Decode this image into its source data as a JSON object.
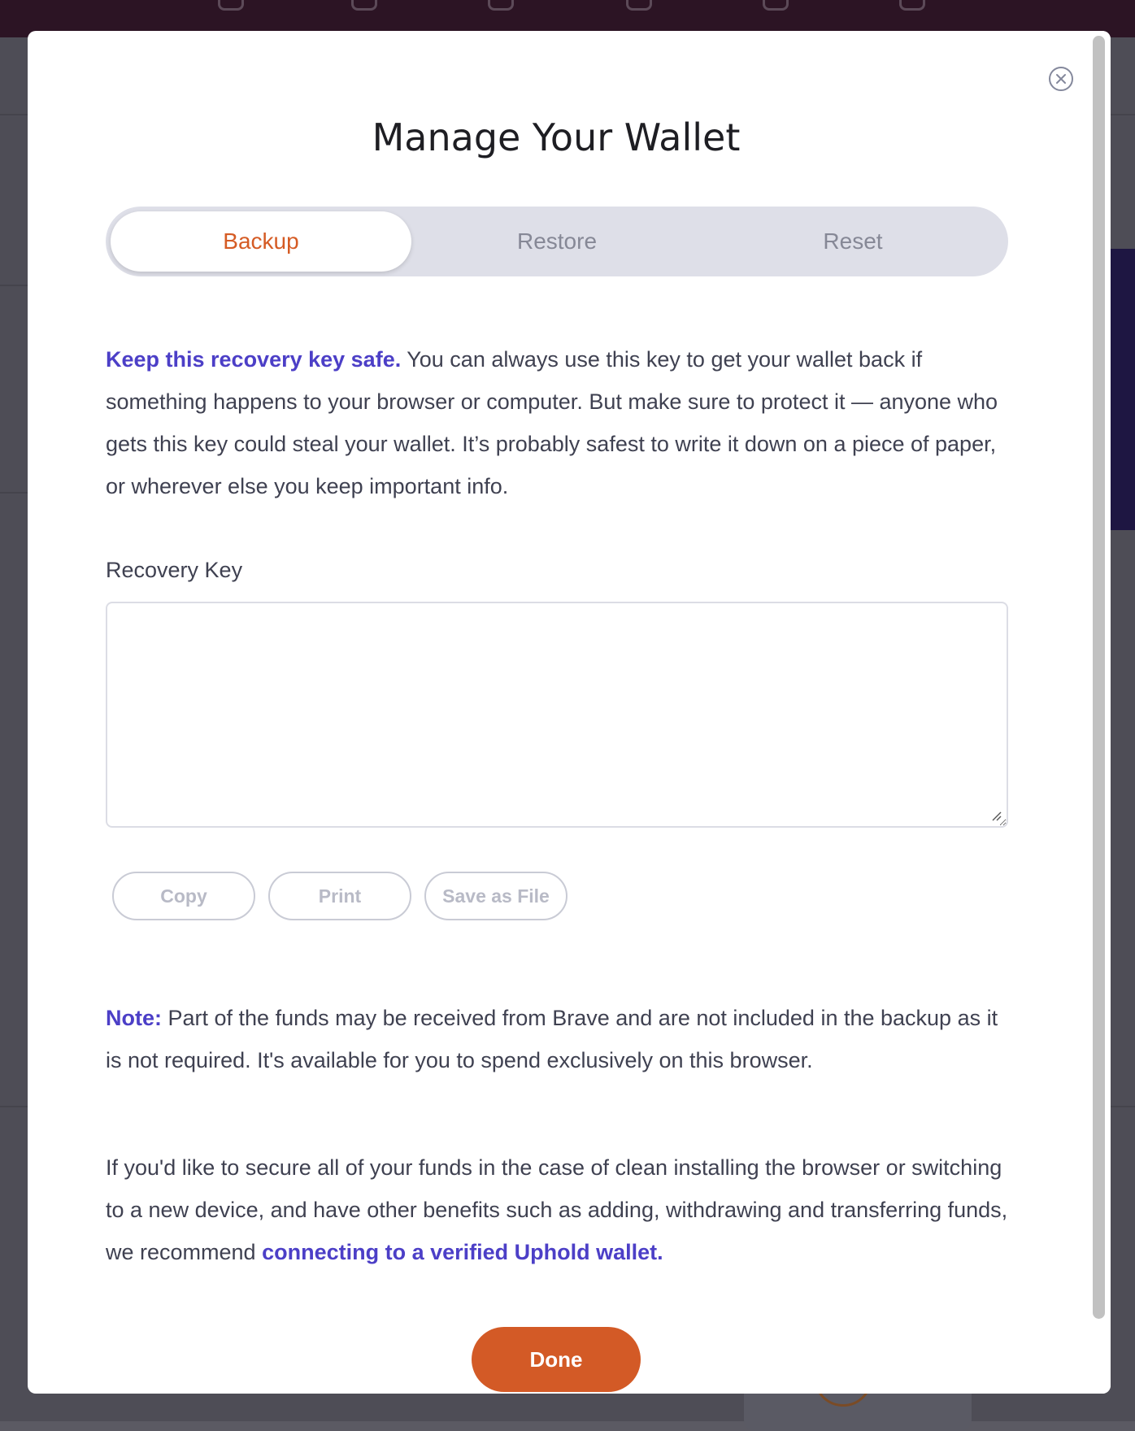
{
  "modal": {
    "title": "Manage Your Wallet",
    "tabs": [
      {
        "label": "Backup",
        "active": true
      },
      {
        "label": "Restore",
        "active": false
      },
      {
        "label": "Reset",
        "active": false
      }
    ],
    "intro": {
      "bold": "Keep this recovery key safe.",
      "text": " You can always use this key to get your wallet back if something happens to your browser or computer. But make sure to protect it — anyone who gets this key could steal your wallet. It’s probably safest to write it down on a piece of paper, or wherever else you keep important info."
    },
    "recovery_key": {
      "label": "Recovery Key",
      "value": ""
    },
    "buttons": {
      "copy": "Copy",
      "print": "Print",
      "save": "Save as File",
      "done": "Done"
    },
    "note": {
      "bold": "Note:",
      "text": " Part of the funds may be received from Brave and are not included in the backup as it is not required. It's available for you to spend exclusively on this browser."
    },
    "recommend": {
      "text": "If you'd like to secure all of your funds in the case of clean installing the browser or switching to a new device, and have other benefits such as adding, withdrawing and transferring funds, we recommend ",
      "link": "connecting to a verified Uphold wallet."
    }
  },
  "colors": {
    "accent": "#d35a26",
    "link": "#4c3fc7",
    "overlay": "#5b5a63"
  },
  "icons": [
    "close-icon",
    "resize-grip-icon"
  ]
}
